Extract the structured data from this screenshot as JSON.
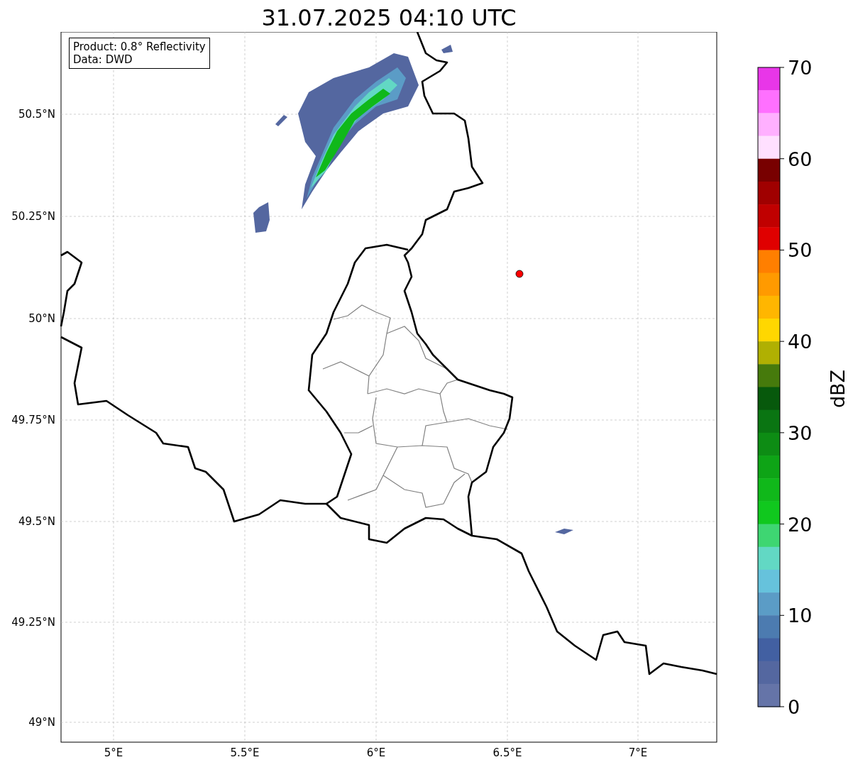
{
  "title": "31.07.2025 04:10 UTC",
  "info_box": [
    "Product: 0.8° Reflectivity",
    "Data: DWD"
  ],
  "map": {
    "lat_labels": [
      "50.5°N",
      "50.25°N",
      "50°N",
      "49.75°N",
      "49.5°N",
      "49.25°N",
      "49°N"
    ],
    "lon_labels": [
      "5°E",
      "5.5°E",
      "6°E",
      "6.5°E",
      "7°E"
    ]
  },
  "colorbar": {
    "label": "dBZ",
    "ticks": [
      "70",
      "60",
      "50",
      "40",
      "30",
      "20",
      "10",
      "0"
    ],
    "levels": [
      {
        "color": "#e836e8"
      },
      {
        "color": "#ff70ff"
      },
      {
        "color": "#ffb0ff"
      },
      {
        "color": "#ffe0ff"
      },
      {
        "color": "#780000"
      },
      {
        "color": "#a00000"
      },
      {
        "color": "#c00000"
      },
      {
        "color": "#e00000"
      },
      {
        "color": "#ff7f00"
      },
      {
        "color": "#ff9a00"
      },
      {
        "color": "#ffb600"
      },
      {
        "color": "#ffd700"
      },
      {
        "color": "#b0b002"
      },
      {
        "color": "#467a0c"
      },
      {
        "color": "#07590c"
      },
      {
        "color": "#0a7512"
      },
      {
        "color": "#0d8c14"
      },
      {
        "color": "#0ea416"
      },
      {
        "color": "#10b81a"
      },
      {
        "color": "#10c81e"
      },
      {
        "color": "#3ed672"
      },
      {
        "color": "#62d8c4"
      },
      {
        "color": "#66c2dc"
      },
      {
        "color": "#5b9cc6"
      },
      {
        "color": "#4c7bb0"
      },
      {
        "color": "#4260a2"
      },
      {
        "color": "#5467a0"
      },
      {
        "color": "#6574a8"
      }
    ]
  }
}
